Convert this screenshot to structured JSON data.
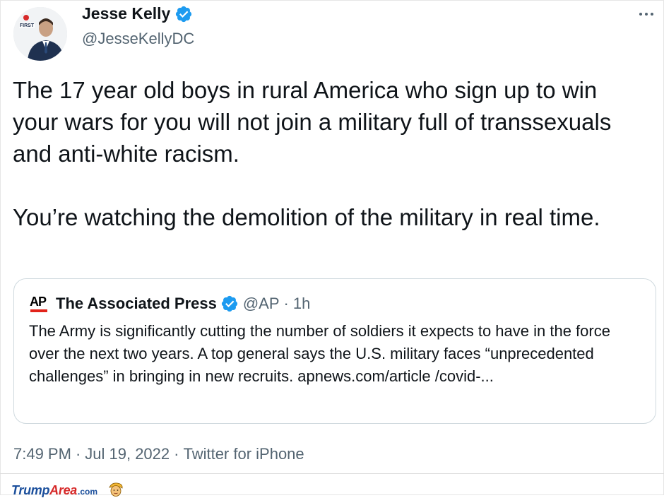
{
  "tweet": {
    "author": {
      "name": "Jesse Kelly",
      "handle": "@JesseKellyDC",
      "avatar_badge_text": "FIRST",
      "verified_color": "#1d9bf0"
    },
    "text_paragraphs": [
      "The 17 year old boys in rural America who sign up to win your wars for you will not join a military full of transsexuals and anti-white racism.",
      "You’re watching the demolition of the military in real time."
    ],
    "quoted": {
      "logo_text": "AP",
      "name": "The Associated Press",
      "handle": "@AP",
      "separator": "·",
      "time": "1h",
      "text": "The Army is significantly cutting the number of soldiers it expects to have in the force over the next two years. A top general says the U.S. military faces “unprecedented challenges”  in bringing in new recruits. apnews.com/article /covid-..."
    },
    "meta": {
      "time": "7:49 PM",
      "separator": "·",
      "date": "Jul 19, 2022",
      "source": "Twitter for iPhone"
    }
  },
  "watermark": {
    "part1": "Trump",
    "part2": "Area",
    "tld": ".com"
  },
  "colors": {
    "text": "#0f1419",
    "secondary": "#536471",
    "border": "#cfd9de",
    "verified": "#1d9bf0",
    "ap_red": "#e2231a"
  },
  "icons": [
    "avatar-photo",
    "verified-badge-icon",
    "more-options-icon",
    "ap-logo",
    "trump-face-icon"
  ]
}
